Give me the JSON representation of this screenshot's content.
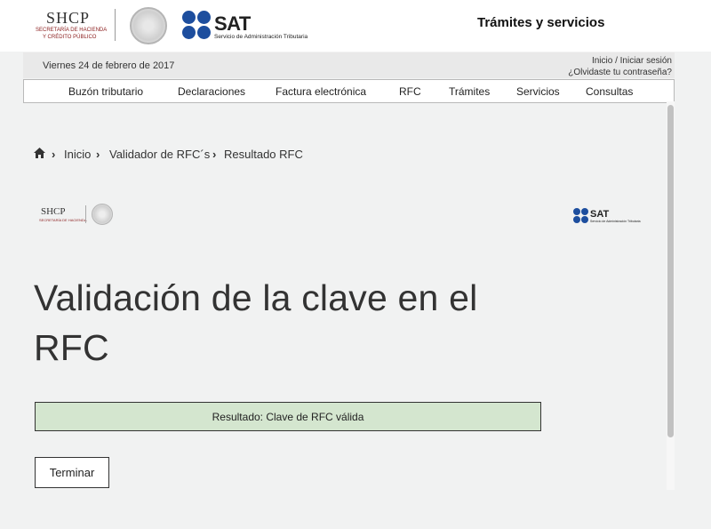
{
  "header": {
    "shcp": {
      "wordmark": "SHCP",
      "line1": "SECRETARÍA DE HACIENDA",
      "line2": "Y CRÉDITO PÚBLICO"
    },
    "sat": {
      "wordmark": "SAT",
      "subtitle": "Servicio de Administración Tributaria",
      "brand_color": "#1d4e9e"
    },
    "tramites_title": "Trámites y servicios"
  },
  "infobar": {
    "date": "Viernes 24 de febrero de 2017",
    "login_link": "Inicio / Iniciar sesión",
    "forgot_link": "¿Olvidaste tu contraseña?"
  },
  "nav": {
    "items": [
      "Buzón tributario",
      "Declaraciones",
      "Factura electrónica",
      "RFC",
      "Trámites",
      "Servicios",
      "Consultas"
    ]
  },
  "breadcrumb": {
    "home_icon": "home-icon",
    "items": [
      "Inicio",
      "Validador de RFC´s",
      "Resultado RFC"
    ]
  },
  "content": {
    "title": "Validación de la clave en el RFC",
    "result_text": "Resultado: Clave de RFC válida",
    "result_color": "#d4e6cf",
    "finish_button": "Terminar"
  }
}
